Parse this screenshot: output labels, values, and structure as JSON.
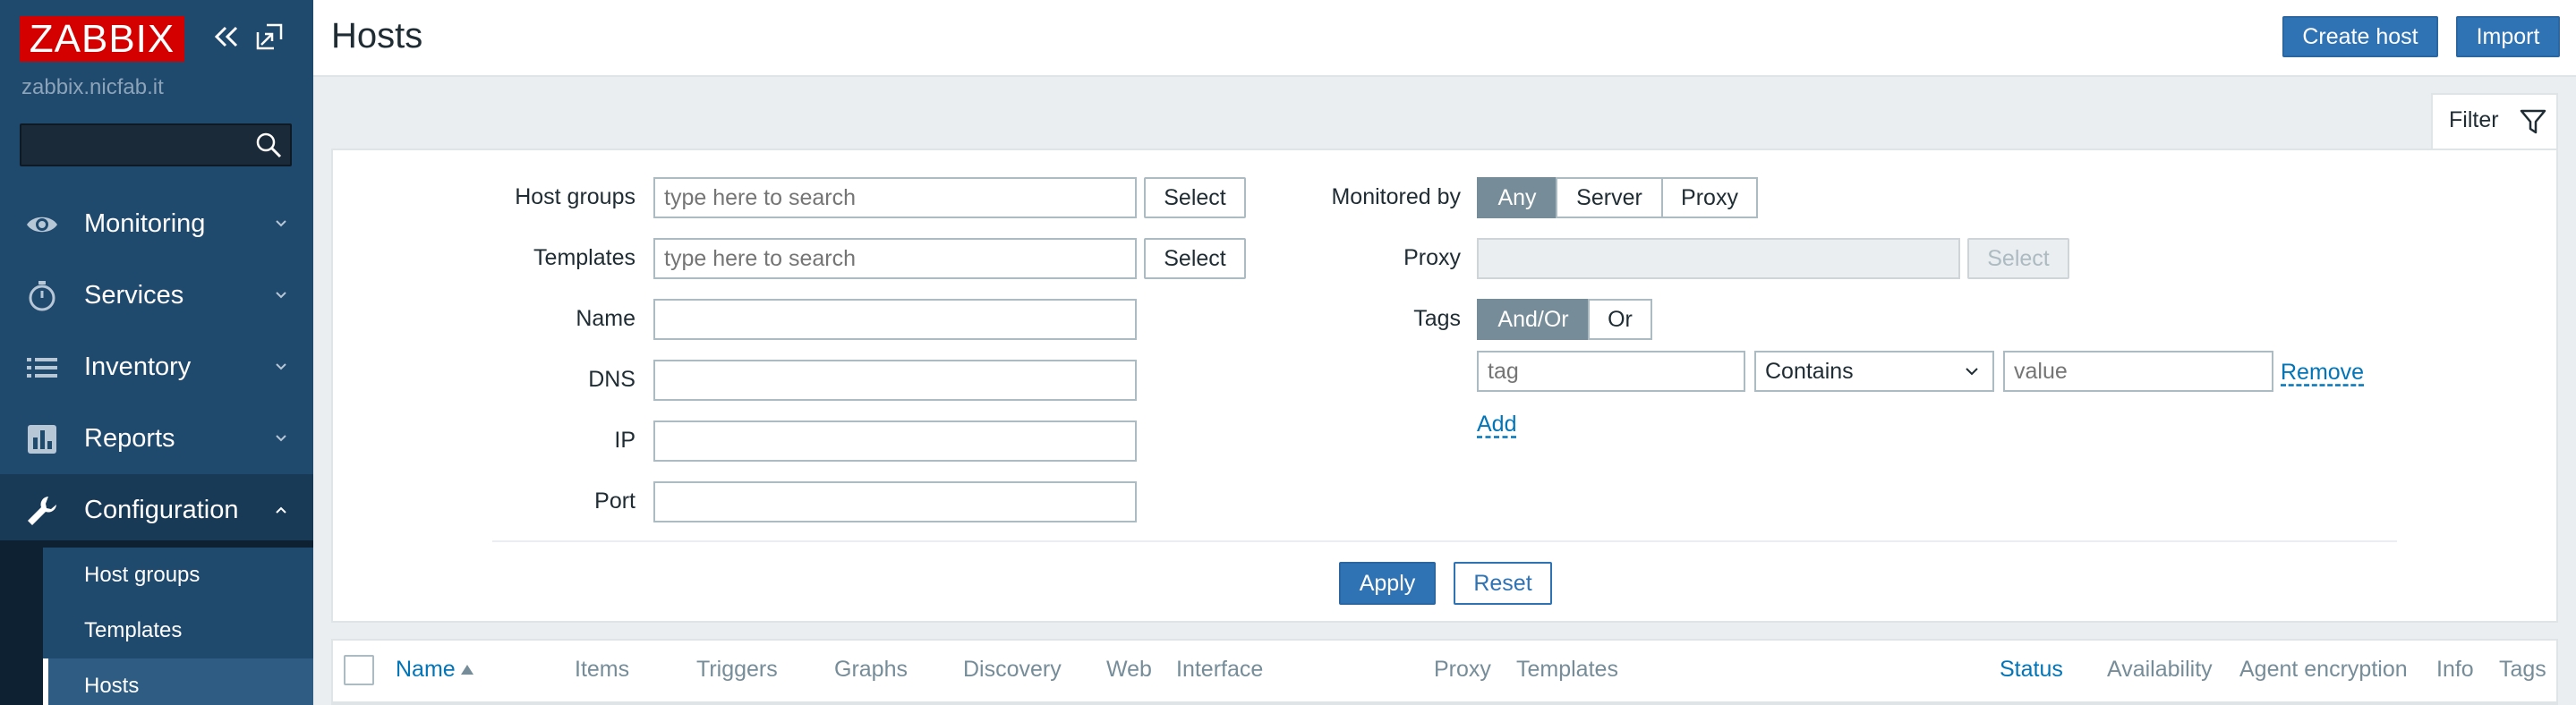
{
  "app": {
    "logo_text": "ZABBIX",
    "server_name": "zabbix.nicfab.it",
    "search": {
      "value": "",
      "placeholder": ""
    }
  },
  "sidebar": {
    "items": [
      {
        "label": "Monitoring",
        "icon": "eye-icon",
        "expanded": false
      },
      {
        "label": "Services",
        "icon": "stopwatch-icon",
        "expanded": false
      },
      {
        "label": "Inventory",
        "icon": "list-icon",
        "expanded": false
      },
      {
        "label": "Reports",
        "icon": "bar-chart-icon",
        "expanded": false
      },
      {
        "label": "Configuration",
        "icon": "wrench-icon",
        "expanded": true
      }
    ],
    "submenu": [
      {
        "label": "Host groups"
      },
      {
        "label": "Templates"
      },
      {
        "label": "Hosts",
        "current": true
      }
    ]
  },
  "header": {
    "title": "Hosts",
    "create_host_label": "Create host",
    "import_label": "Import"
  },
  "filter": {
    "tab_label": "Filter",
    "host_groups": {
      "label": "Host groups",
      "placeholder": "type here to search",
      "select_label": "Select"
    },
    "templates": {
      "label": "Templates",
      "placeholder": "type here to search",
      "select_label": "Select"
    },
    "name": {
      "label": "Name",
      "value": ""
    },
    "dns": {
      "label": "DNS",
      "value": ""
    },
    "ip": {
      "label": "IP",
      "value": ""
    },
    "port": {
      "label": "Port",
      "value": ""
    },
    "monitored_by": {
      "label": "Monitored by",
      "options": [
        "Any",
        "Server",
        "Proxy"
      ],
      "selected": "Any"
    },
    "proxy": {
      "label": "Proxy",
      "select_label": "Select"
    },
    "tags": {
      "label": "Tags",
      "options": [
        "And/Or",
        "Or"
      ],
      "selected": "And/Or",
      "tag_placeholder": "tag",
      "operator": "Contains",
      "value_placeholder": "value",
      "remove_label": "Remove",
      "add_label": "Add"
    },
    "apply_label": "Apply",
    "reset_label": "Reset"
  },
  "table": {
    "columns": [
      {
        "label": "Name",
        "sortable": true,
        "sorted": "asc"
      },
      {
        "label": "Items"
      },
      {
        "label": "Triggers"
      },
      {
        "label": "Graphs"
      },
      {
        "label": "Discovery"
      },
      {
        "label": "Web"
      },
      {
        "label": "Interface"
      },
      {
        "label": "Proxy"
      },
      {
        "label": "Templates"
      },
      {
        "label": "Status",
        "sortable": true
      },
      {
        "label": "Availability"
      },
      {
        "label": "Agent encryption"
      },
      {
        "label": "Info"
      },
      {
        "label": "Tags"
      }
    ]
  },
  "colors": {
    "sidebar_bg": "#1f4a6e",
    "logo_bg": "#d40000",
    "primary": "#2f73b5",
    "link": "#0275b8",
    "segment_selected": "#768d99"
  }
}
